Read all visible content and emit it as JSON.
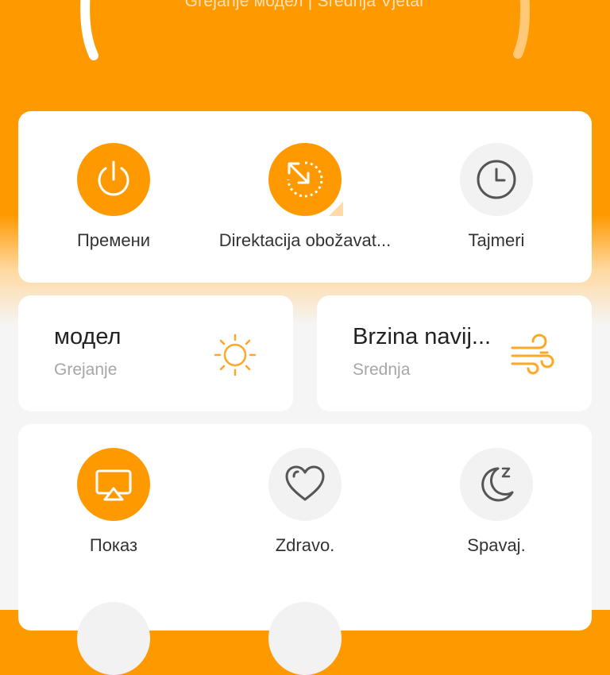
{
  "header": {
    "subtitle": "Grejanje модел | Srednja Vjetar"
  },
  "controls": [
    {
      "label": "Премени",
      "icon": "power-icon",
      "active": true
    },
    {
      "label": "Direktacija obožavat...",
      "icon": "fan-direction-icon",
      "active": true
    },
    {
      "label": "Tajmeri",
      "icon": "clock-icon",
      "active": false
    }
  ],
  "mode": {
    "title": "модел",
    "value": "Grejanje",
    "icon": "sun-icon"
  },
  "wind": {
    "title": "Brzina navij...",
    "value": "Srednja",
    "icon": "wind-icon"
  },
  "functions": [
    {
      "label": "Показ",
      "icon": "display-icon",
      "active": true
    },
    {
      "label": "Zdravo.",
      "icon": "heart-icon",
      "active": false
    },
    {
      "label": "Spavaj.",
      "icon": "moon-sleep-icon",
      "active": false
    }
  ],
  "colors": {
    "accent": "#FF9900",
    "inactive_circle": "#F2F2F2",
    "text_primary": "#333333",
    "text_secondary": "#A6A6A6"
  }
}
